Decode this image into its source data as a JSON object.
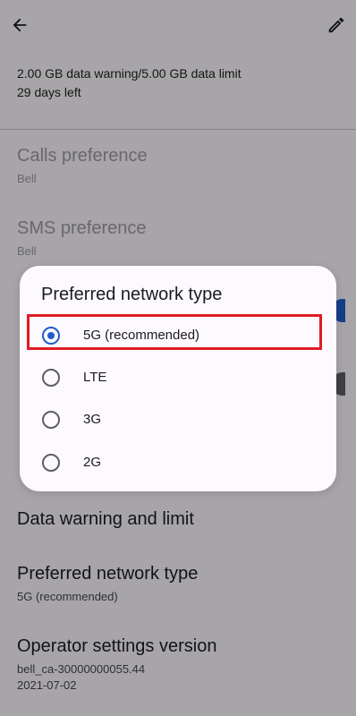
{
  "header": {
    "back_icon": "arrow-left-icon",
    "edit_icon": "pencil-icon"
  },
  "usage": {
    "line1": "2.00 GB data warning/5.00 GB data limit",
    "line2": "29 days left"
  },
  "background_items": [
    {
      "title": "Calls preference",
      "subtitle": "Bell",
      "enabled": false
    },
    {
      "title": "SMS preference",
      "subtitle": "Bell",
      "enabled": false
    },
    {
      "title": "Data warning and limit"
    },
    {
      "title": "Preferred network type",
      "subtitle": "5G (recommended)"
    },
    {
      "title": "Operator settings version",
      "subtitle_line1": "bell_ca-30000000055.44",
      "subtitle_line2": "2021-07-02"
    }
  ],
  "dialog": {
    "title": "Preferred network type",
    "options": [
      {
        "label": "5G (recommended)",
        "selected": true
      },
      {
        "label": "LTE",
        "selected": false
      },
      {
        "label": "3G",
        "selected": false
      },
      {
        "label": "2G",
        "selected": false
      }
    ]
  },
  "colors": {
    "accent": "#1f5ccc",
    "highlight": "#e01b24"
  }
}
